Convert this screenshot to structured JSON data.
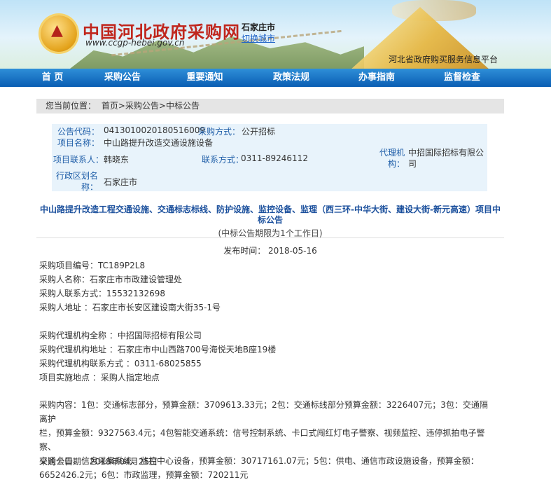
{
  "header": {
    "site_title": "中国河北政府采购网",
    "site_url": "www.ccgp-hebei.gov.cn",
    "city": "石家庄市",
    "switch_city": "切换城市",
    "platform": "河北省政府购买服务信息平台"
  },
  "nav": [
    "首 页",
    "采购公告",
    "重要通知",
    "政策法规",
    "办事指南",
    "监督检查"
  ],
  "breadcrumb": {
    "prefix": "您当前位置：",
    "path": "首页>采购公告>中标公告"
  },
  "info": {
    "code_label": "公告代码：",
    "code_value": "04130100201805160",
    "code_value2": "09",
    "method_label": "采购方式：",
    "method_value": "公开招标",
    "name_label": "项目名称：",
    "name_value": "中山路提升改造交通设施设备",
    "contact_label": "项目联系人：",
    "contact_value": "韩晓东",
    "phone_label": "联系方式：",
    "phone_value": "0311-89246112",
    "agency_label": "代理机构：",
    "agency_value": "中招国际招标有限公司",
    "region_label": "行政区划名称：",
    "region_value": "石家庄市"
  },
  "notice": {
    "title_line1": "中山路提升改造工程交通设施、交通标志标线、防护设施、监控设备、监理（西三环-中华大街、建设大街-新元高速）项目中",
    "title_line2": "标公告",
    "subtitle": "(中标公告期限为1个工作日)",
    "pub_label": "发布时间：",
    "pub_date": "2018-05-16"
  },
  "body": {
    "project_no": "采购项目编号：TC189P2L8",
    "buyer_name": "采购人名称：石家庄市市政建设管理处",
    "buyer_phone": "采购人联系方式：15532132698",
    "buyer_addr": "采购人地址 ：石家庄市长安区建设南大街35-1号",
    "agency_name": "采购代理机构全称 ：中招国际招标有限公司",
    "agency_addr": "采购代理机构地址 ：石家庄市中山西路700号海悦天地B座19楼",
    "agency_phone": "采购代理机构联系方式 ：0311-68025855",
    "site": "项目实施地点 ：采购人指定地点",
    "content_l1": "采购内容：1包：交通标志部分，预算金额：3709613.33元；2包：交通标线部分预算金额：3226407元；3包：交通隔离护",
    "content_l2": "栏，预算金额：9327563.4元；4包智能交通系统：信号控制系统、卡口式闯红灯电子警察、视频监控、违停抓拍电子警察、",
    "content_l3": "交通卡口、信息采集系统、监控中心设备，预算金额：30717161.07元；5包：供电、通信市政设施设备，预算金额：",
    "content_l4": "6652426.2元；6包：市政监理，预算金额：720211元",
    "notice_date": "采购公告期：2018年04月25日"
  }
}
